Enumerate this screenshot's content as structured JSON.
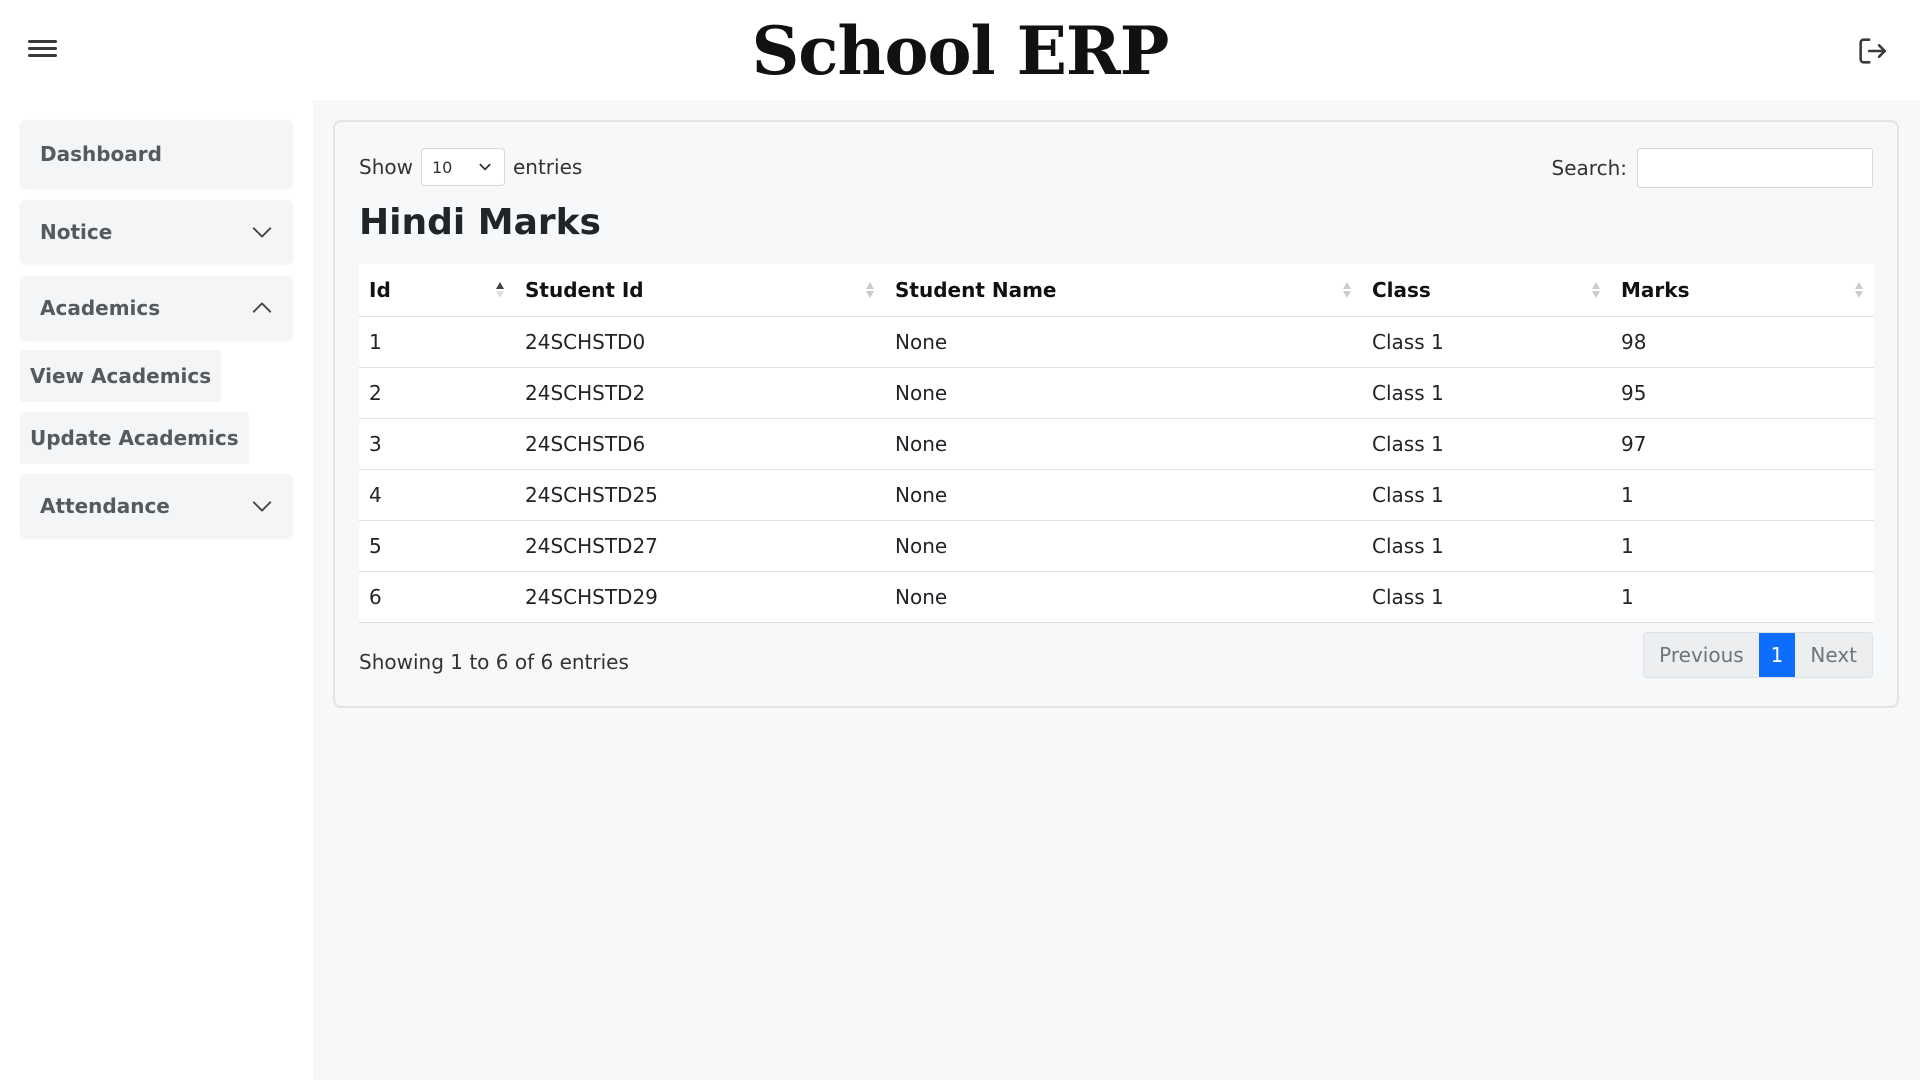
{
  "header": {
    "title": "School ERP",
    "menu_icon": "hamburger-menu-icon",
    "logout_icon": "logout-icon"
  },
  "sidebar": {
    "items": [
      {
        "label": "Dashboard"
      },
      {
        "label": "Notice",
        "expanded": false
      },
      {
        "label": "Academics",
        "expanded": true
      },
      {
        "label": "Attendance",
        "expanded": false
      }
    ],
    "academics_sub": [
      {
        "label": "View Academics"
      },
      {
        "label": "Update Academics"
      }
    ]
  },
  "table_controls": {
    "show_label": "Show",
    "entries_value": "10",
    "entries_label": "entries",
    "search_label": "Search:",
    "search_value": ""
  },
  "table_title": "Hindi Marks",
  "table": {
    "columns": [
      "Id",
      "Student Id",
      "Student Name",
      "Class",
      "Marks"
    ],
    "rows": [
      [
        "1",
        "24SCHSTD0",
        "None",
        "Class 1",
        "98"
      ],
      [
        "2",
        "24SCHSTD2",
        "None",
        "Class 1",
        "95"
      ],
      [
        "3",
        "24SCHSTD6",
        "None",
        "Class 1",
        "97"
      ],
      [
        "4",
        "24SCHSTD25",
        "None",
        "Class 1",
        "1"
      ],
      [
        "5",
        "24SCHSTD27",
        "None",
        "Class 1",
        "1"
      ],
      [
        "6",
        "24SCHSTD29",
        "None",
        "Class 1",
        "1"
      ]
    ]
  },
  "footer": {
    "info": "Showing 1 to 6 of 6 entries",
    "pagination": {
      "previous": "Previous",
      "current": "1",
      "next": "Next"
    }
  },
  "colors": {
    "accent": "#0d6efd",
    "sidebar_item_bg": "#f4f5f7",
    "main_bg": "#f7f8f9"
  }
}
